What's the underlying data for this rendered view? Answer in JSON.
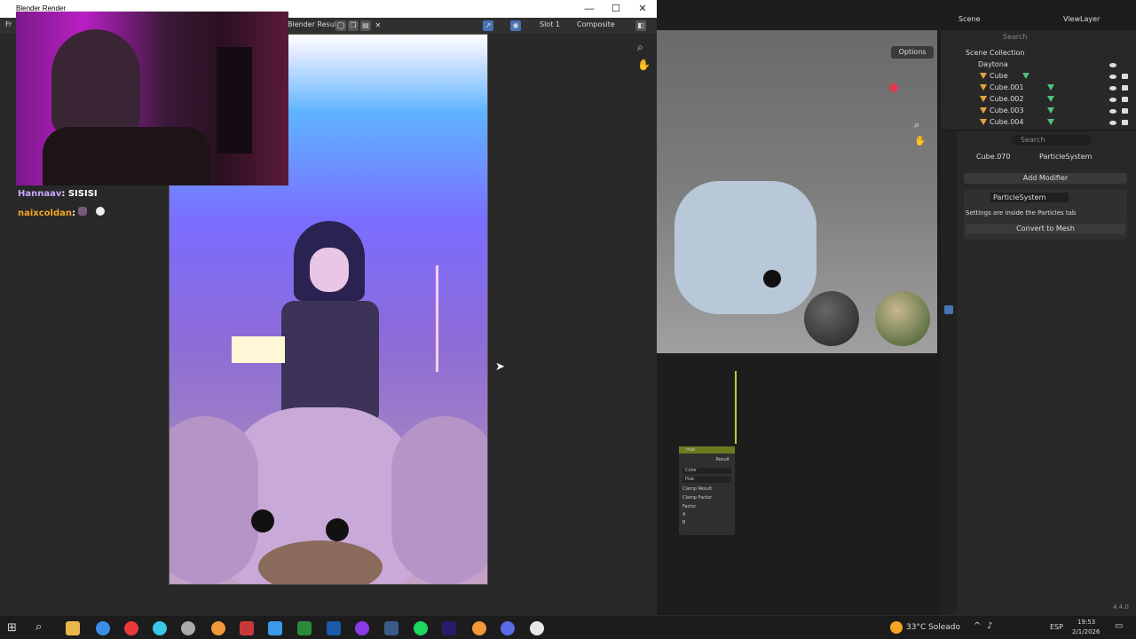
{
  "render_window": {
    "title": "Blender Render",
    "left_label": "Fr",
    "image_name": "Blender Result",
    "slot": "Slot 1",
    "pass": "Composite",
    "controls": {
      "minimize": "—",
      "maximize": "☐",
      "close": "✕"
    }
  },
  "chat": [
    {
      "user": "Hannaav",
      "text": "SISISI",
      "color": "#c8a8ff"
    },
    {
      "user": "naixcoldan",
      "text": "",
      "color": "#f5a623"
    }
  ],
  "viewport": {
    "options": "Options"
  },
  "outliner": {
    "scene": "Scene",
    "view_layer": "ViewLayer",
    "search": "Search",
    "collection": "Scene Collection",
    "items": [
      {
        "label": "Daytona"
      },
      {
        "label": "Cube"
      },
      {
        "label": "Cube.001"
      },
      {
        "label": "Cube.002"
      },
      {
        "label": "Cube.003"
      },
      {
        "label": "Cube.004"
      }
    ]
  },
  "properties": {
    "search": "Search",
    "object": "Cube.070",
    "system": "ParticleSystem",
    "add_modifier": "Add Modifier",
    "modifier_name": "ParticleSystem",
    "info": "Settings are inside the Particles tab",
    "convert": "Convert to Mesh",
    "version": "4.4.0"
  },
  "node": {
    "title": "Hue",
    "result": "Result",
    "color": "Color",
    "hue": "Hue",
    "clamp_result": "Clamp Result",
    "clamp_factor": "Clamp Factor",
    "factor": "Factor",
    "a": "A",
    "b": "B"
  },
  "taskbar": {
    "weather": "33°C",
    "condition": "Soleado",
    "lang": "ESP",
    "time": "19:53",
    "date": "2/1/2026"
  },
  "colors": {
    "accent": "#4772b3",
    "node_header": "#6b7a1f"
  }
}
